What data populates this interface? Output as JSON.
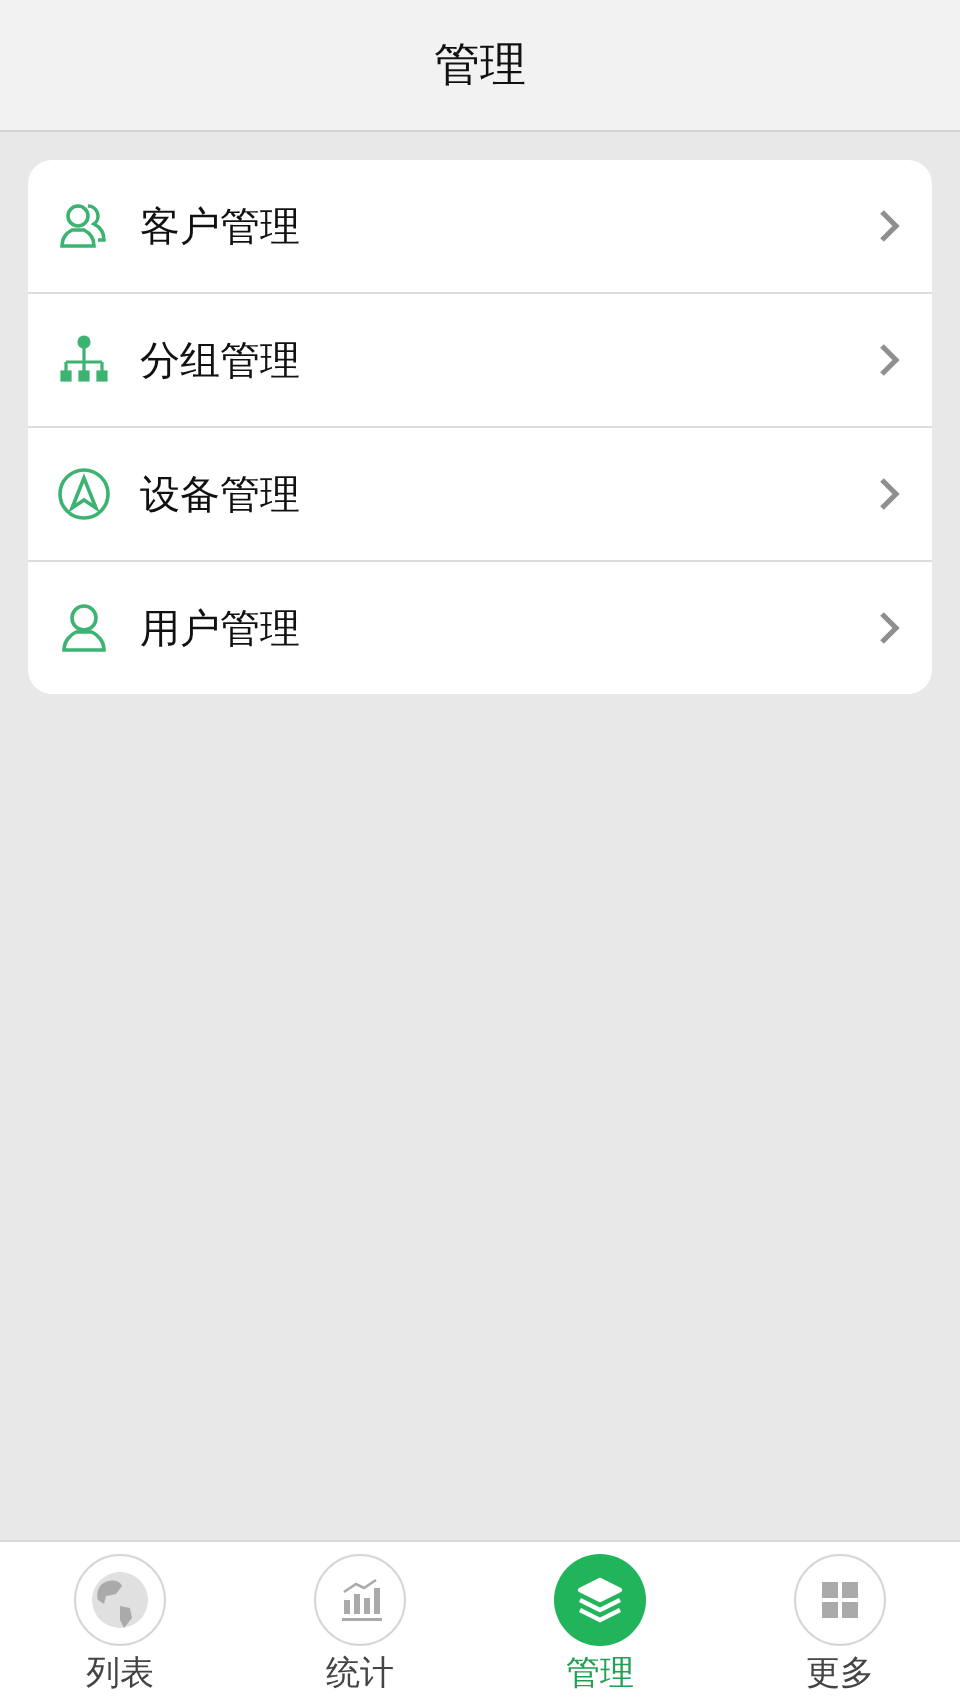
{
  "header": {
    "title": "管理"
  },
  "menu": [
    {
      "label": "客户管理",
      "kind": "customers"
    },
    {
      "label": "分组管理",
      "kind": "groups"
    },
    {
      "label": "设备管理",
      "kind": "devices"
    },
    {
      "label": "用户管理",
      "kind": "user"
    }
  ],
  "tabs": [
    {
      "label": "列表",
      "kind": "globe",
      "selected": false
    },
    {
      "label": "统计",
      "kind": "chart",
      "selected": false
    },
    {
      "label": "管理",
      "kind": "layers",
      "selected": true
    },
    {
      "label": "更多",
      "kind": "grid",
      "selected": false
    }
  ]
}
